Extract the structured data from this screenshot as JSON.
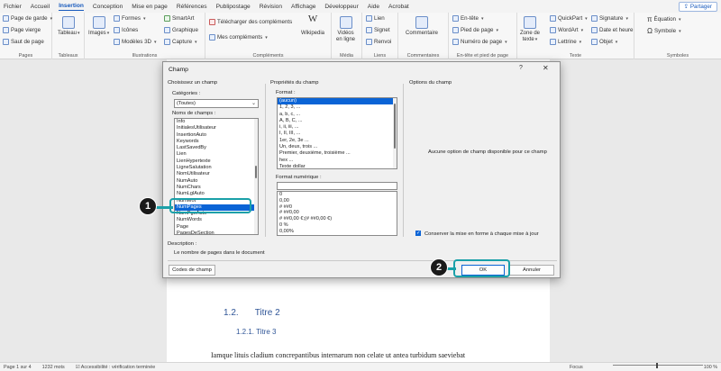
{
  "menu": {
    "tabs": [
      "Fichier",
      "Accueil",
      "Insertion",
      "Conception",
      "Mise en page",
      "Références",
      "Publipostage",
      "Révision",
      "Affichage",
      "Développeur",
      "Aide",
      "Acrobat"
    ],
    "active_index": 2,
    "share": "Partager"
  },
  "ribbon": {
    "pages": {
      "label": "Pages",
      "cover": "Page de garde",
      "blank": "Page vierge",
      "break": "Saut de page"
    },
    "tables": {
      "label": "Tableaux",
      "table": "Tableau"
    },
    "illustrations": {
      "label": "Illustrations",
      "images": "Images",
      "shapes": "Formes",
      "icons": "Icônes",
      "models3d": "Modèles 3D",
      "smartart": "SmartArt",
      "chart": "Graphique",
      "capture": "Capture"
    },
    "addins": {
      "label": "Compléments",
      "get": "Télécharger des compléments",
      "mine": "Mes compléments",
      "wikipedia": "Wikipedia"
    },
    "media": {
      "label": "Média",
      "video_line1": "Vidéos",
      "video_line2": "en ligne"
    },
    "links": {
      "label": "Liens",
      "link": "Lien",
      "bookmark": "Signet",
      "crossref": "Renvoi"
    },
    "comments": {
      "label": "Commentaires",
      "comment": "Commentaire"
    },
    "headerfooter": {
      "label": "En-tête et pied de page",
      "header": "En-tête",
      "footer": "Pied de page",
      "pagenum": "Numéro de page"
    },
    "text": {
      "label": "Texte",
      "textbox_line1": "Zone de",
      "textbox_line2": "texte",
      "quickpart": "QuickPart",
      "wordart": "WordArt",
      "dropcap": "Lettrine",
      "signature": "Signature",
      "datetime": "Date et heure",
      "object": "Objet"
    },
    "symbols": {
      "label": "Symboles",
      "equation": "Équation",
      "symbol": "Symbole"
    }
  },
  "document": {
    "heading2_num": "1.2.",
    "heading2_text": "Titre 2",
    "heading3": "1.2.1. Titre 3",
    "body": "Iamque lituis cladium concrepantibus internarum non celate ut antea turbidum saeviebat"
  },
  "statusbar": {
    "page": "Page 1 sur 4",
    "words": "1232 mots",
    "accessibility": "Accessibilité : vérification terminée",
    "focus": "Focus",
    "zoom": "100 %"
  },
  "dialog": {
    "title": "Champ",
    "help": "?",
    "close": "✕",
    "choose_header": "Choisissez un champ",
    "categories_label": "Catégories :",
    "categories_value": "(Toutes)",
    "field_names_label": "Noms de champs :",
    "field_names": [
      "Info",
      "InitialesUtilisateur",
      "InsertionAuto",
      "Keywords",
      "LastSavedBy",
      "Lien",
      "LienHypertexte",
      "LigneSalutation",
      "NomUtilisateur",
      "NumAuto",
      "NumChars",
      "NumLglAuto",
      "NumMot",
      "NumPages",
      "NumPgeAuto",
      "NumWords",
      "Page",
      "PagesDeSection"
    ],
    "selected_field": "NumPages",
    "props_header": "Propriétés du champ",
    "format_label": "Format :",
    "formats": [
      "(aucun)",
      "1, 2, 3, ...",
      "a, b, c, ...",
      "A, B, C, ...",
      "i, ii, iii, ...",
      "I, II, III, ...",
      "1er, 2e, 3e ...",
      "Un, deux, trois ...",
      "Premier, deuxième, troisième ...",
      "hex ...",
      "Texte dollar"
    ],
    "numeric_format_label": "Format numérique :",
    "numeric_formats": [
      "0",
      "0,00",
      "# ##0",
      "# ##0,00",
      "# ##0,00 €;(# ##0,00 €)",
      "0 %",
      "0,00%"
    ],
    "options_header": "Options du champ",
    "no_options": "Aucune option de champ disponible pour ce champ",
    "preserve_label": "Conserver la mise en forme à chaque mise à jour",
    "preserve_checked": true,
    "description_label": "Description :",
    "description": "Le nombre de pages dans le document",
    "field_codes_button": "Codes de champ",
    "ok_button": "OK",
    "cancel_button": "Annuler"
  },
  "annotations": {
    "step1": "1",
    "step2": "2",
    "accent": "#1aa0a8"
  }
}
